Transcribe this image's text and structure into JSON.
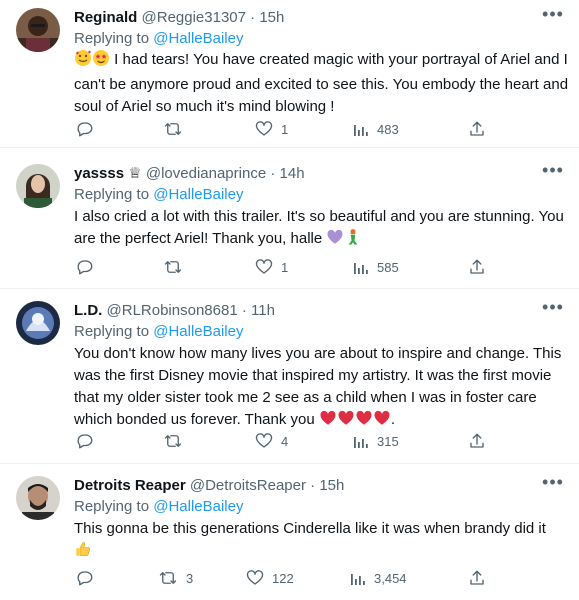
{
  "tweets": [
    {
      "name": "Reginald",
      "handle": "@Reggie31307",
      "separator": "·",
      "time": "15h",
      "replying_prefix": "Replying to",
      "replying_to": "@HalleBailey",
      "text": "I had tears! You have created magic with your portrayal of Ariel and I can't be anymore proud and excited to see this. You embody the heart and soul of Ariel so much it's mind blowing !",
      "emojis": [
        "smiling-face-hearts",
        "star-struck"
      ],
      "replies": "",
      "retweets": "",
      "likes": "1",
      "views": "483"
    },
    {
      "name": "yassss",
      "name_emoji": "♕",
      "handle": "@lovedianaprince",
      "separator": "·",
      "time": "14h",
      "replying_prefix": "Replying to",
      "replying_to": "@HalleBailey",
      "text": "I also cried a lot with this trailer. It's so beautiful and you are stunning. You are the perfect Ariel! Thank you, halle",
      "emojis": [
        "purple-heart",
        "mermaid"
      ],
      "replies": "",
      "retweets": "",
      "likes": "1",
      "views": "585"
    },
    {
      "name": "L.D.",
      "handle": "@RLRobinson8681",
      "separator": "·",
      "time": "11h",
      "replying_prefix": "Replying to",
      "replying_to": "@HalleBailey",
      "text": "You don't know how many lives you are about to inspire and change. This was the first Disney movie that inspired my artistry. It was the first movie that my older sister took me 2 see as a child when I was in foster care which bonded us forever. Thank you",
      "trailing": ".",
      "emojis": [
        "red-heart",
        "red-heart",
        "red-heart",
        "red-heart"
      ],
      "replies": "",
      "retweets": "",
      "likes": "4",
      "views": "315"
    },
    {
      "name": "Detroits Reaper",
      "handle": "@DetroitsReaper",
      "separator": "·",
      "time": "15h",
      "replying_prefix": "Replying to",
      "replying_to": "@HalleBailey",
      "text": "This gonna be this generations Cinderella like it was when brandy did it",
      "emojis": [
        "thumbs-up"
      ],
      "replies": "",
      "retweets": "3",
      "likes": "122",
      "views": "3,454"
    }
  ],
  "colors": {
    "text": "#0f1419",
    "secondary": "#536471",
    "link": "#1d9bf0",
    "divider": "#eff3f4"
  }
}
